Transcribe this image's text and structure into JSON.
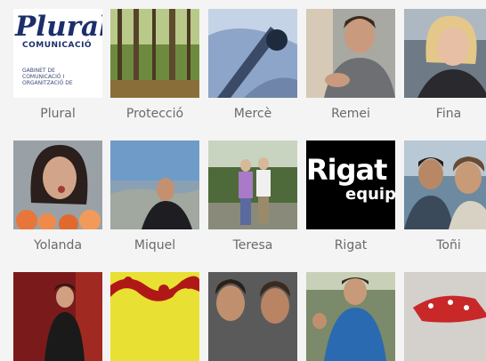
{
  "tiles": [
    {
      "name": "Plural"
    },
    {
      "name": "Protecció"
    },
    {
      "name": "Mercè"
    },
    {
      "name": "Remei"
    },
    {
      "name": "Fina"
    },
    {
      "name": "Yolanda"
    },
    {
      "name": "Miquel"
    },
    {
      "name": "Teresa"
    },
    {
      "name": "Rigat"
    },
    {
      "name": "Toñi"
    },
    {
      "name": ""
    },
    {
      "name": ""
    },
    {
      "name": ""
    },
    {
      "name": ""
    },
    {
      "name": ""
    }
  ],
  "plural_logo": {
    "title": "Plural",
    "subtitle": "COMUNICACIÓ",
    "small": "GABINET DE COMUNICACIÓ I ORGANITZACIÓ DE"
  },
  "rigat_logo": {
    "big": "Rigat",
    "small": "equip"
  }
}
